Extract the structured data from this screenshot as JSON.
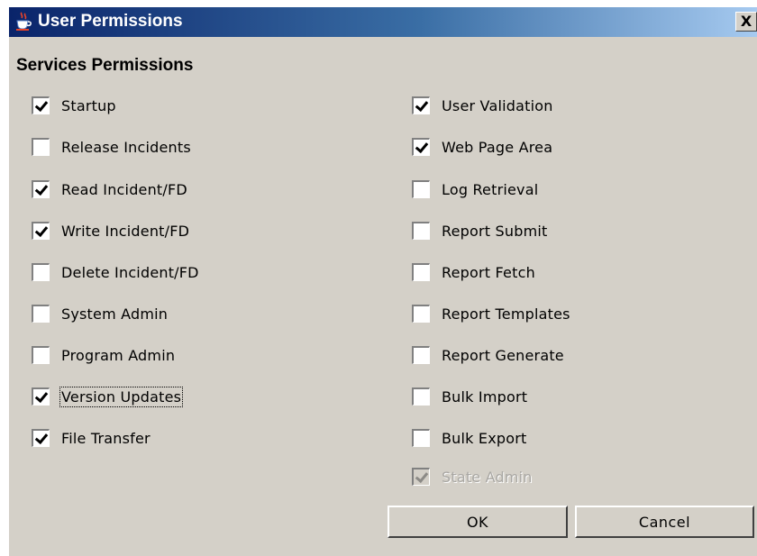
{
  "window": {
    "title": "User Permissions",
    "close_label": "X"
  },
  "section_title": "Services Permissions",
  "permissions": {
    "left": [
      {
        "label": "Startup",
        "checked": true
      },
      {
        "label": "Release Incidents",
        "checked": false
      },
      {
        "label": "Read Incident/FD",
        "checked": true
      },
      {
        "label": "Write Incident/FD",
        "checked": true
      },
      {
        "label": "Delete Incident/FD",
        "checked": false
      },
      {
        "label": "System Admin",
        "checked": false
      },
      {
        "label": "Program Admin",
        "checked": false
      },
      {
        "label": "Version Updates",
        "checked": true,
        "focused": true
      },
      {
        "label": "File Transfer",
        "checked": true
      }
    ],
    "right": [
      {
        "label": "User Validation",
        "checked": true
      },
      {
        "label": "Web Page Area",
        "checked": true
      },
      {
        "label": "Log Retrieval",
        "checked": false
      },
      {
        "label": "Report Submit",
        "checked": false
      },
      {
        "label": "Report Fetch",
        "checked": false
      },
      {
        "label": "Report Templates",
        "checked": false
      },
      {
        "label": "Report Generate",
        "checked": false
      },
      {
        "label": "Bulk Import",
        "checked": false
      },
      {
        "label": "Bulk Export",
        "checked": false
      },
      {
        "label": "State Admin",
        "checked": true,
        "disabled": true
      }
    ]
  },
  "buttons": {
    "ok_label": "OK",
    "cancel_label": "Cancel"
  },
  "colors": {
    "title_gradient_start": "#0a246a",
    "title_gradient_end": "#a6caf0",
    "dialog_background": "#d4d0c8"
  },
  "icons": {
    "title_icon": "java-coffee-cup-icon",
    "close_icon": "close-icon"
  }
}
